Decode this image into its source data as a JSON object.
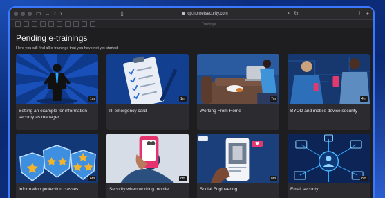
{
  "browser": {
    "url": "cp.hornetsecurity.com",
    "tab_label": "Trainings"
  },
  "page": {
    "title": "Pending e-trainings",
    "subtitle": "Here you will find all e-trainings that you have not yet started."
  },
  "trainings": [
    {
      "title": "Setting an example for information security as manager",
      "duration": "1m",
      "icon": "manager-illustration"
    },
    {
      "title": "IT emergency card",
      "duration": "1m",
      "icon": "checklist-illustration"
    },
    {
      "title": "Working From Home",
      "duration": "7m",
      "icon": "home-office-illustration"
    },
    {
      "title": "BYOD and mobile device security",
      "duration": "4m",
      "icon": "mobile-device-illustration"
    },
    {
      "title": "Information protection classes",
      "duration": "6m",
      "icon": "shields-stars-illustration"
    },
    {
      "title": "Security when working mobile",
      "duration": "8m",
      "icon": "phone-in-hand-illustration"
    },
    {
      "title": "Social Engineering",
      "duration": "8m",
      "icon": "social-media-illustration"
    },
    {
      "title": "Email security",
      "duration": "8m",
      "icon": "network-illustration"
    }
  ],
  "colors": {
    "accent_border": "#3a78ff",
    "card_bg": "#2c2c30",
    "thumb_bg": "#0e2a57"
  }
}
